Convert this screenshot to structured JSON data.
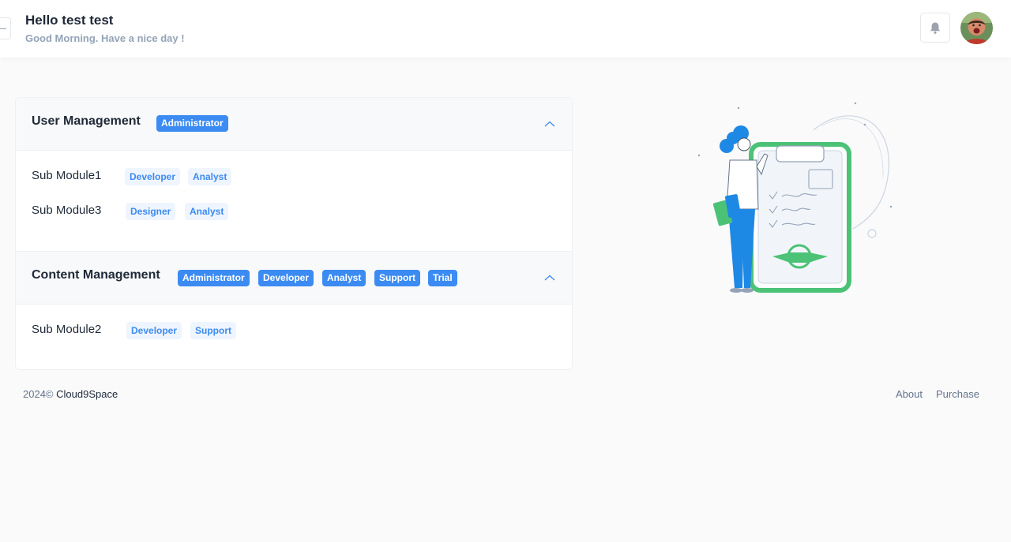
{
  "header": {
    "greeting": "Hello test test",
    "subtitle": "Good Morning. Have a nice day !",
    "collapse_icon": "minus-icon",
    "bell_icon": "bell-icon",
    "avatar_icon": "user-avatar"
  },
  "modules": [
    {
      "title": "User Management",
      "roles": [
        "Administrator"
      ],
      "submodules": [
        {
          "name": "Sub Module1",
          "roles": [
            "Developer",
            "Analyst"
          ]
        },
        {
          "name": "Sub Module3",
          "roles": [
            "Designer",
            "Analyst"
          ]
        }
      ]
    },
    {
      "title": "Content Management",
      "roles": [
        "Administrator",
        "Developer",
        "Analyst",
        "Support",
        "Trial"
      ],
      "submodules": [
        {
          "name": "Sub Module2",
          "roles": [
            "Developer",
            "Support"
          ]
        }
      ]
    }
  ],
  "footer": {
    "year": "2024©",
    "brand": "Cloud9Space",
    "links": [
      "About",
      "Purchase"
    ]
  },
  "colors": {
    "accent": "#3b8bf2",
    "pill_bg": "#eff5fe",
    "illustration_green": "#4cc276",
    "illustration_blue": "#1e88e5"
  }
}
